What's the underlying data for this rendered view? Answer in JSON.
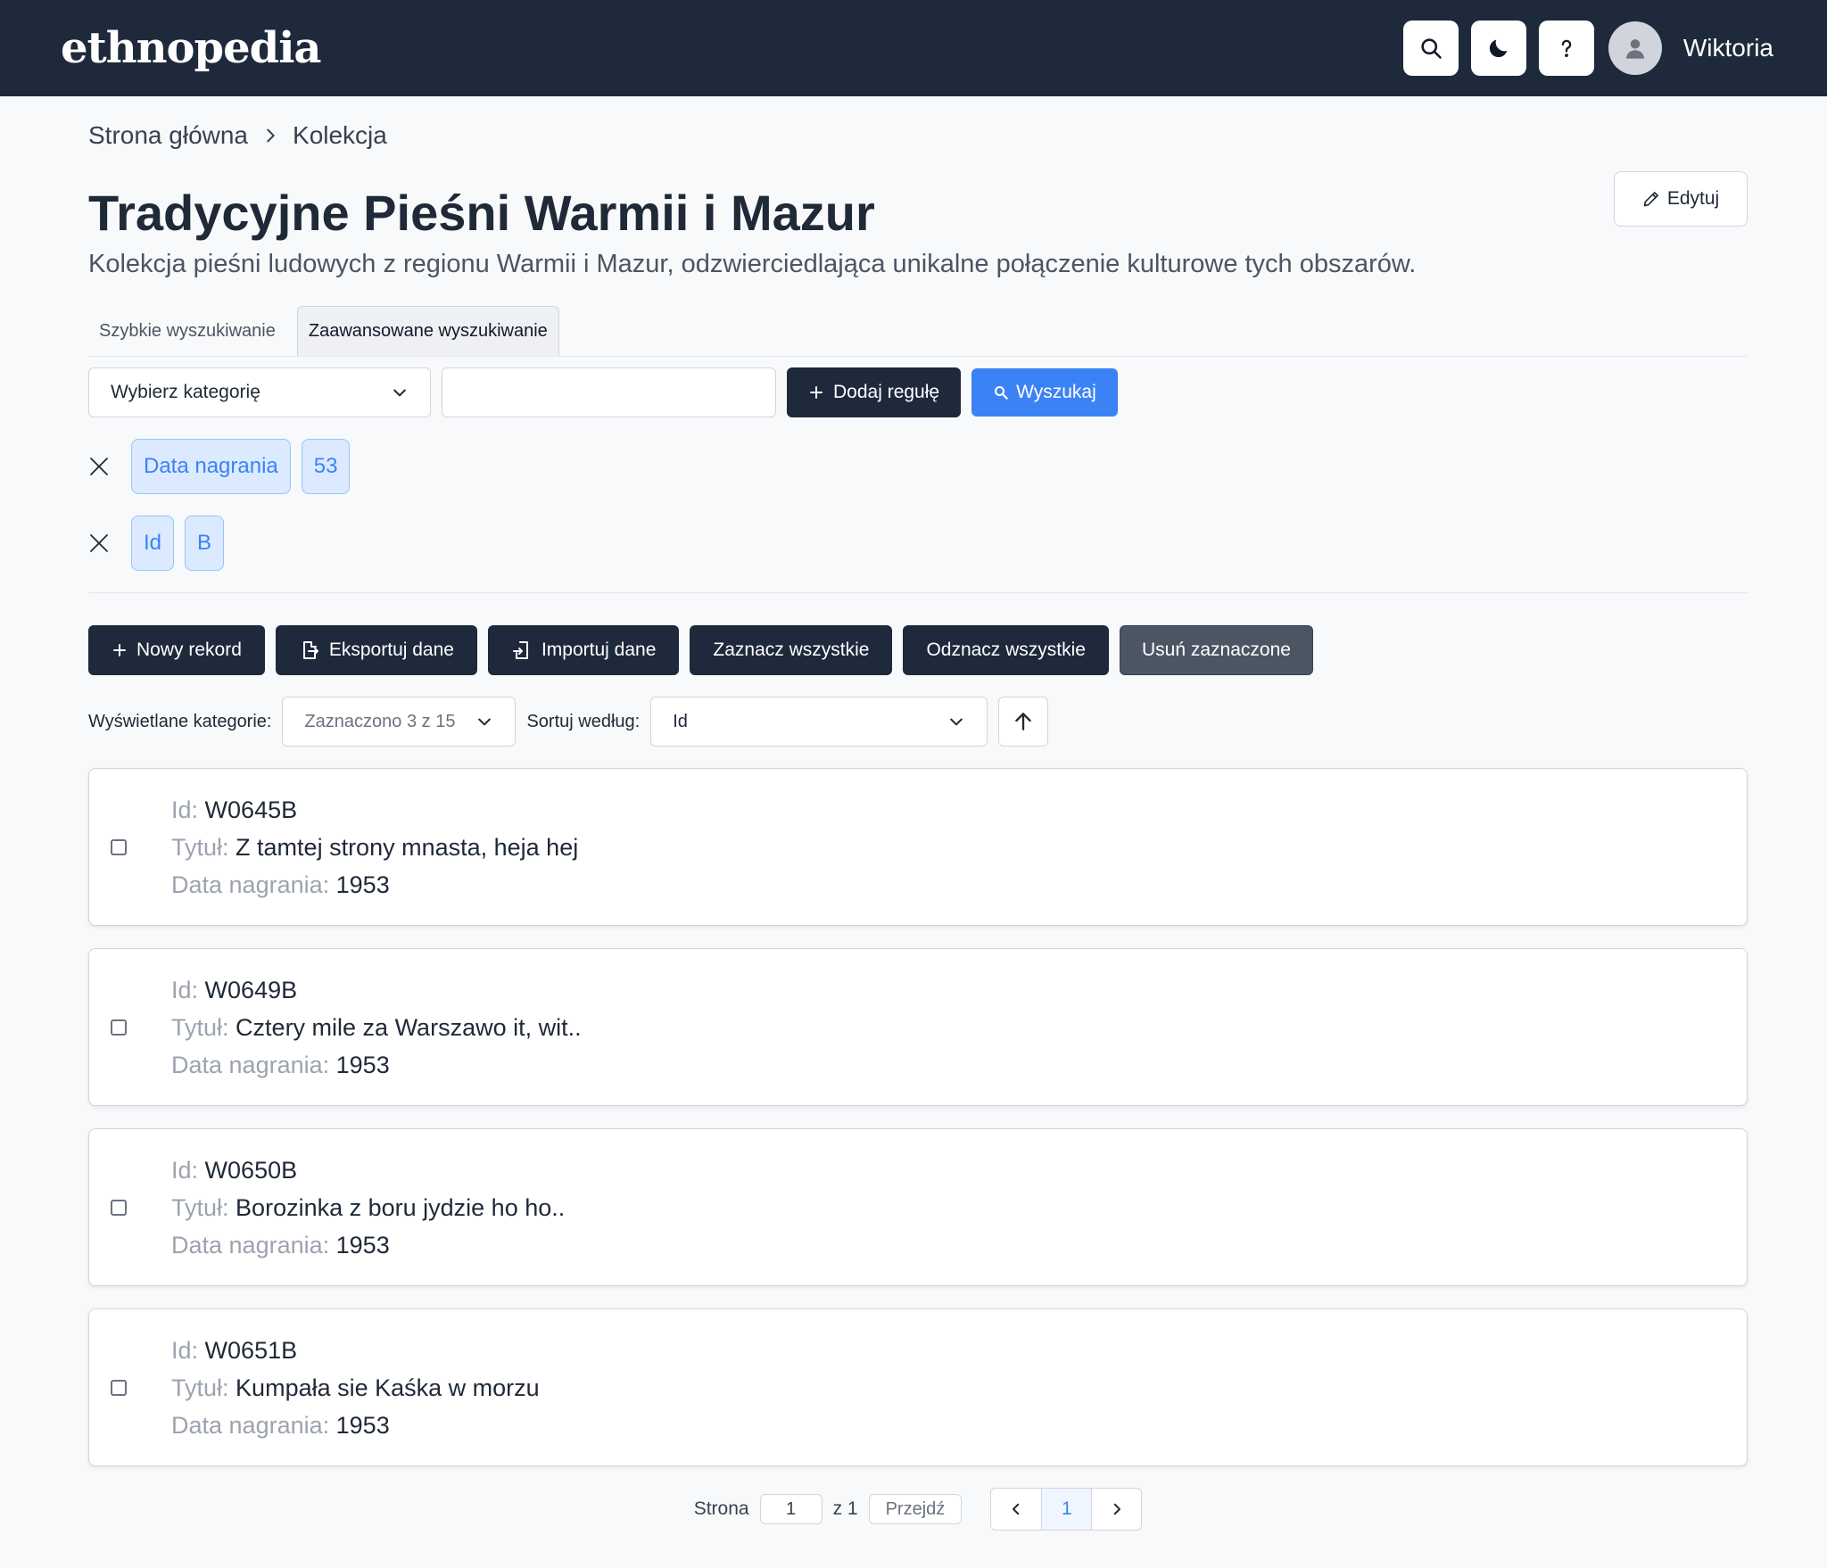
{
  "header": {
    "logo": "ethnopedia",
    "user_name": "Wiktoria",
    "icons": [
      "search-icon",
      "moon-icon",
      "help-icon",
      "user-avatar-icon"
    ]
  },
  "breadcrumb": {
    "home": "Strona główna",
    "current": "Kolekcja"
  },
  "collection": {
    "title": "Tradycyjne Pieśni Warmii i Mazur",
    "description": "Kolekcja pieśni ludowych z regionu Warmii i Mazur, odzwierciedlająca unikalne połączenie kulturowe tych obszarów.",
    "edit_label": "Edytuj"
  },
  "search": {
    "tabs": [
      "Szybkie wyszukiwanie",
      "Zaawansowane wyszukiwanie"
    ],
    "active_tab": "Zaawansowane wyszukiwanie",
    "category_placeholder": "Wybierz kategorię",
    "value_input": "",
    "add_rule_label": "Dodaj regułę",
    "search_label": "Wyszukaj",
    "rules": [
      {
        "category": "Data nagrania",
        "value": "53"
      },
      {
        "category": "Id",
        "value": "B"
      }
    ]
  },
  "actions": {
    "new_record": "Nowy rekord",
    "export": "Eksportuj dane",
    "import": "Importuj dane",
    "select_all": "Zaznacz wszystkie",
    "deselect_all": "Odznacz wszystkie",
    "delete_selected": "Usuń zaznaczone"
  },
  "filters": {
    "displayed_categories_label": "Wyświetlane kategorie:",
    "displayed_categories_value": "Zaznaczono 3 z 15",
    "sort_label": "Sortuj według:",
    "sort_value": "Id",
    "sort_direction": "ascending"
  },
  "records": [
    {
      "id_label": "Id:",
      "id": "W0645B",
      "title_label": "Tytuł:",
      "title": "Z tamtej strony mnasta, heja hej",
      "date_label": "Data nagrania:",
      "date": "1953"
    },
    {
      "id_label": "Id:",
      "id": "W0649B",
      "title_label": "Tytuł:",
      "title": "Cztery mile za Warszawo it, wit..",
      "date_label": "Data nagrania:",
      "date": "1953"
    },
    {
      "id_label": "Id:",
      "id": "W0650B",
      "title_label": "Tytuł:",
      "title": "Borozinka z boru jydzie ho ho..",
      "date_label": "Data nagrania:",
      "date": "1953"
    },
    {
      "id_label": "Id:",
      "id": "W0651B",
      "title_label": "Tytuł:",
      "title": "Kumpała sie Kaśka w morzu",
      "date_label": "Data nagrania:",
      "date": "1953"
    }
  ],
  "pagination": {
    "page_label": "Strona",
    "page_input": "1",
    "of_label": "z 1",
    "go_label": "Przejdź",
    "current_page": "1"
  },
  "colors": {
    "header_bg": "#1e293b",
    "primary_dark": "#1e293b",
    "accent_blue": "#3b82f6",
    "chip_bg": "#dbeafe"
  }
}
